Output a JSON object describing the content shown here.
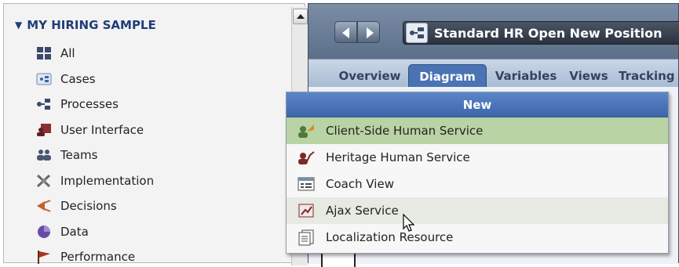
{
  "library": {
    "header": "MY HIRING SAMPLE",
    "items": [
      {
        "label": "All",
        "icon": "grid-icon"
      },
      {
        "label": "Cases",
        "icon": "cases-icon"
      },
      {
        "label": "Processes",
        "icon": "process-icon"
      },
      {
        "label": "User Interface",
        "icon": "user-interface-icon"
      },
      {
        "label": "Teams",
        "icon": "teams-icon"
      },
      {
        "label": "Implementation",
        "icon": "tools-icon"
      },
      {
        "label": "Decisions",
        "icon": "decisions-icon"
      },
      {
        "label": "Data",
        "icon": "data-icon"
      },
      {
        "label": "Performance",
        "icon": "flag-icon"
      }
    ]
  },
  "editor": {
    "title": "Standard HR Open New Position",
    "tabs": [
      {
        "label": "Overview",
        "active": false
      },
      {
        "label": "Diagram",
        "active": true
      },
      {
        "label": "Variables",
        "active": false
      },
      {
        "label": "Views",
        "active": false
      },
      {
        "label": "Tracking",
        "active": false
      }
    ]
  },
  "popup": {
    "header": "New",
    "items": [
      {
        "label": "Client-Side Human Service",
        "icon": "client-side-human-service-icon",
        "state": "highlighted"
      },
      {
        "label": "Heritage Human Service",
        "icon": "heritage-human-service-icon",
        "state": "normal"
      },
      {
        "label": "Coach View",
        "icon": "coach-view-icon",
        "state": "normal"
      },
      {
        "label": "Ajax Service",
        "icon": "ajax-service-icon",
        "state": "hover"
      },
      {
        "label": "Localization Resource",
        "icon": "localization-resource-icon",
        "state": "normal"
      }
    ]
  },
  "colors": {
    "accent": "#4a73b3",
    "highlight": "#b9d3a4",
    "header_text": "#1f3d78"
  }
}
